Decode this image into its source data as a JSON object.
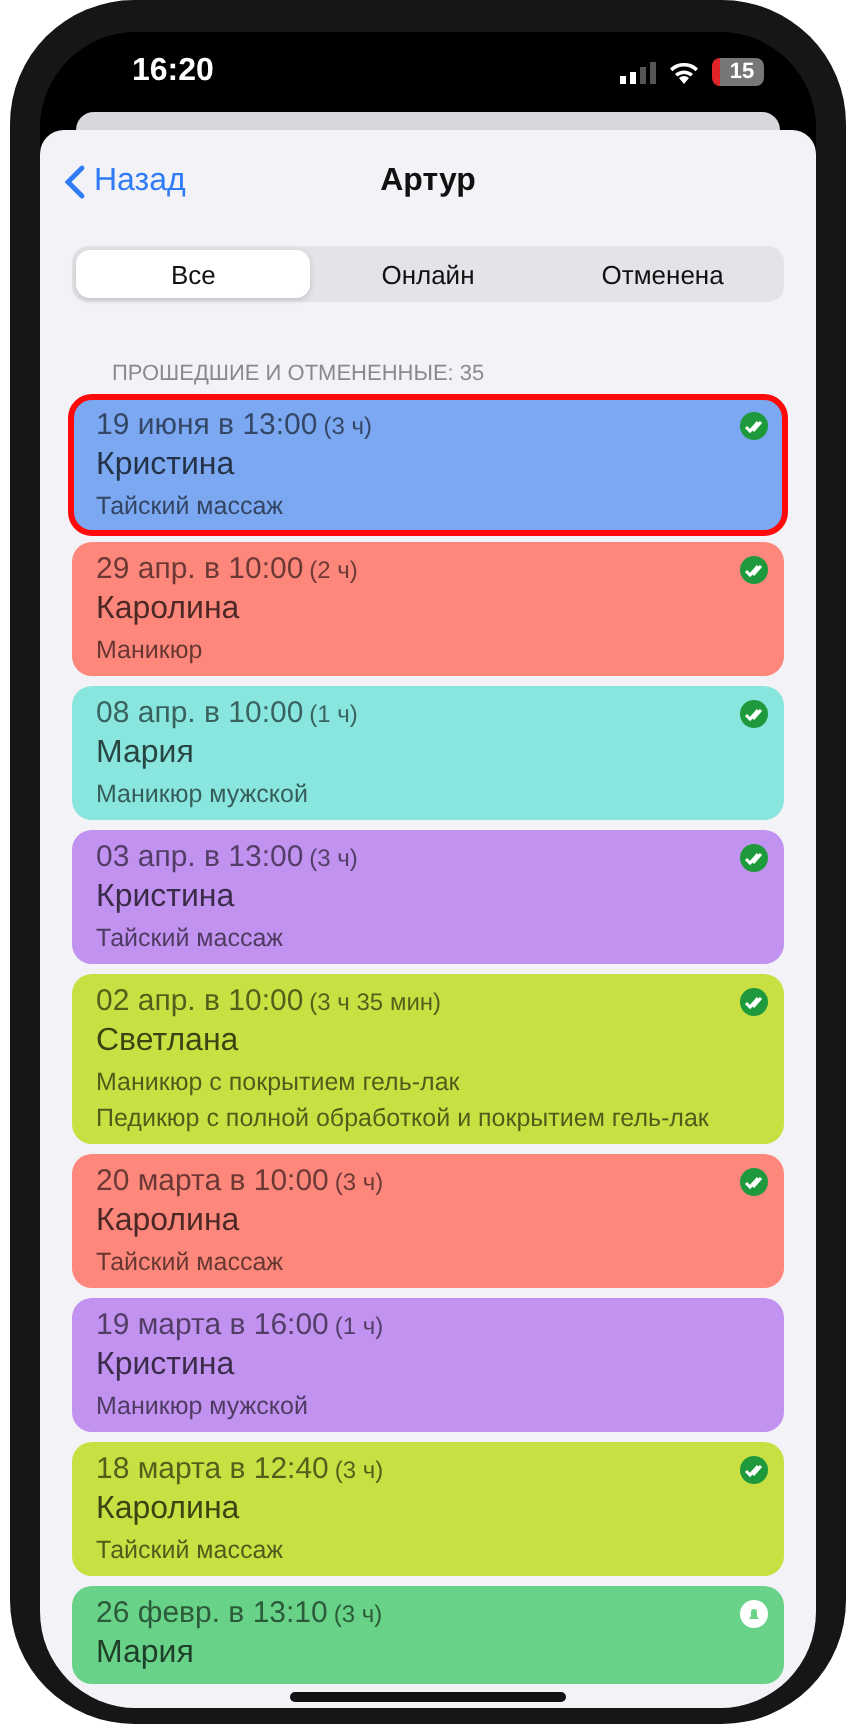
{
  "status_bar": {
    "time": "16:20",
    "battery": "15"
  },
  "nav": {
    "back": "Назад",
    "title": "Артур"
  },
  "tabs": [
    {
      "label": "Все",
      "selected": true
    },
    {
      "label": "Онлайн",
      "selected": false
    },
    {
      "label": "Отменена",
      "selected": false
    }
  ],
  "section_header": "ПРОШЕДШИЕ И ОТМЕНЕННЫЕ: 35",
  "appointments": [
    {
      "kind": "confirmed",
      "date": "19 июня в 13:00",
      "duration": "(3 ч)",
      "client": "Кристина",
      "services": [
        "Тайский массаж"
      ],
      "color": "#7ba8f0",
      "selected": true
    },
    {
      "kind": "confirmed",
      "date": "29 апр. в 10:00",
      "duration": "(2 ч)",
      "client": "Каролина",
      "services": [
        "Маникюр"
      ],
      "color": "#fe877c",
      "selected": false
    },
    {
      "kind": "confirmed",
      "date": "08 апр. в 10:00",
      "duration": "(1 ч)",
      "client": "Мария",
      "services": [
        "Маникюр мужской"
      ],
      "color": "#88e6de",
      "selected": false
    },
    {
      "kind": "confirmed",
      "date": "03 апр. в 13:00",
      "duration": "(3 ч)",
      "client": "Кристина",
      "services": [
        "Тайский массаж"
      ],
      "color": "#c192f0",
      "selected": false
    },
    {
      "kind": "confirmed",
      "date": "02 апр. в 10:00",
      "duration": "(3 ч 35 мин)",
      "client": "Светлана",
      "services": [
        "Маникюр с покрытием гель-лак",
        "Педикюр с полной обработкой и покрытием гель-лак"
      ],
      "color": "#c8e042",
      "selected": false
    },
    {
      "kind": "confirmed",
      "date": "20 марта в 10:00",
      "duration": "(3 ч)",
      "client": "Каролина",
      "services": [
        "Тайский массаж"
      ],
      "color": "#fe877c",
      "selected": false
    },
    {
      "kind": "plain",
      "date": "19 марта в 16:00",
      "duration": "(1 ч)",
      "client": "Кристина",
      "services": [
        "Маникюр мужской"
      ],
      "color": "#c192f0",
      "selected": false
    },
    {
      "kind": "confirmed",
      "date": "18 марта в 12:40",
      "duration": "(3 ч)",
      "client": "Каролина",
      "services": [
        "Тайский массаж"
      ],
      "color": "#c8e042",
      "selected": false
    },
    {
      "kind": "reminder",
      "date": "26 февр. в 13:10",
      "duration": "(3 ч)",
      "client": "Мария",
      "color": "#68d388",
      "selected": false
    }
  ]
}
